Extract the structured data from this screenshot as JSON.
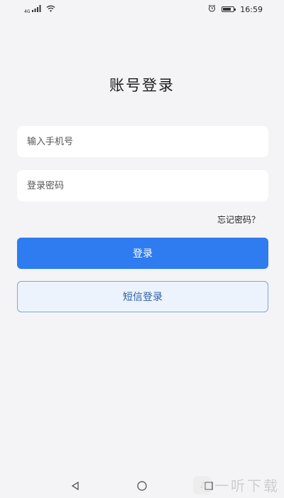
{
  "status_bar": {
    "network": "4G",
    "time": "16:59",
    "battery_level": 0.8
  },
  "page": {
    "title": "账号登录"
  },
  "form": {
    "phone_placeholder": "输入手机号",
    "password_placeholder": "登录密码",
    "forgot_label": "忘记密码？",
    "login_label": "登录",
    "sms_login_label": "短信登录"
  },
  "watermark": {
    "text": "一听下载"
  },
  "colors": {
    "primary": "#2f7cf0",
    "secondary_bg": "#ecf3fd",
    "secondary_border": "#7ea6da",
    "background": "#f4f4f6"
  }
}
